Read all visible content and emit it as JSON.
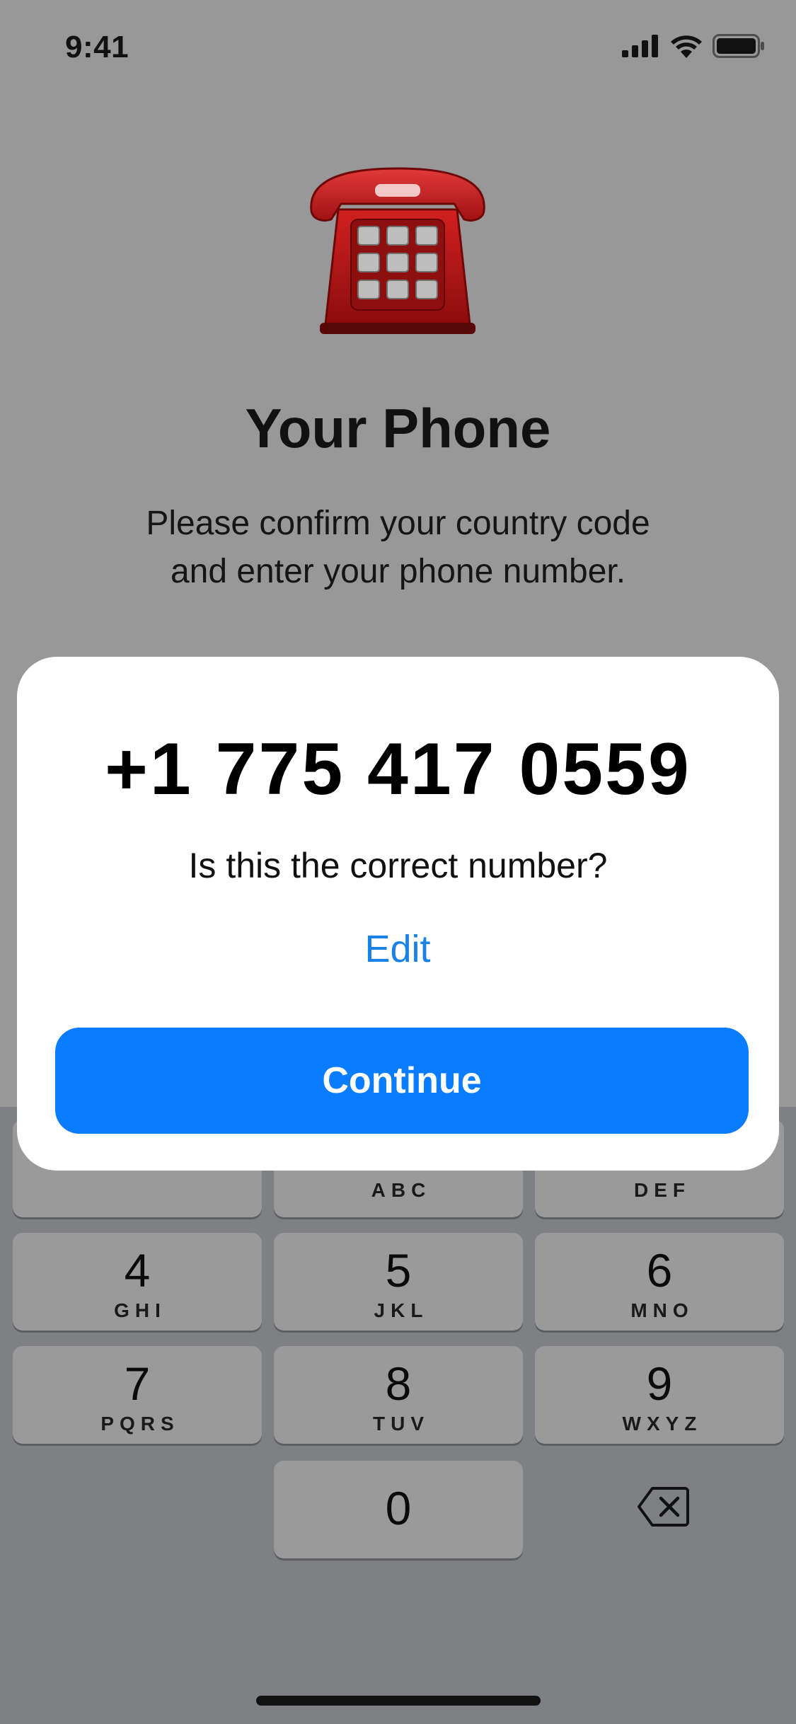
{
  "status_bar": {
    "time": "9:41",
    "icons": [
      "cellular-signal-icon",
      "wifi-icon",
      "battery-icon"
    ]
  },
  "header": {
    "emoji": "telephone-emoji",
    "title": "Your Phone",
    "subtitle_line1": "Please confirm your country code",
    "subtitle_line2": "and enter your phone number."
  },
  "dialog": {
    "phone_number": "+1 775 417 0559",
    "question": "Is this the correct number?",
    "edit_label": "Edit",
    "continue_label": "Continue"
  },
  "keypad": {
    "keys": [
      {
        "digit": "",
        "letters": ""
      },
      {
        "digit": "",
        "letters": "ABC"
      },
      {
        "digit": "",
        "letters": "DEF"
      },
      {
        "digit": "4",
        "letters": "GHI"
      },
      {
        "digit": "5",
        "letters": "JKL"
      },
      {
        "digit": "6",
        "letters": "MNO"
      },
      {
        "digit": "7",
        "letters": "PQRS"
      },
      {
        "digit": "8",
        "letters": "TUV"
      },
      {
        "digit": "9",
        "letters": "WXYZ"
      },
      {
        "digit": "0",
        "letters": ""
      }
    ],
    "backspace_icon": "backspace-icon"
  },
  "colors": {
    "accent": "#0a7cff",
    "link": "#1a82e6",
    "overlay_background": "#989898",
    "keypad_background": "#7f8083",
    "key_background": "#9a9a9b"
  }
}
